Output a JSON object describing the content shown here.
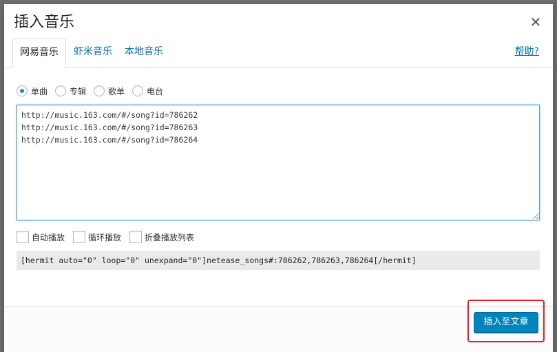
{
  "dialog": {
    "title": "插入音乐",
    "close_icon": "close-icon"
  },
  "tabs": [
    {
      "label": "网易音乐",
      "active": true
    },
    {
      "label": "虾米音乐",
      "active": false
    },
    {
      "label": "本地音乐",
      "active": false
    }
  ],
  "help_link": "帮助?",
  "type_options": [
    {
      "label": "单曲",
      "checked": true
    },
    {
      "label": "专辑",
      "checked": false
    },
    {
      "label": "歌单",
      "checked": false
    },
    {
      "label": "电台",
      "checked": false
    }
  ],
  "url_input": {
    "lines": [
      "http://music.163.com/#/song?id=786262",
      "http://music.163.com/#/song?id=786263",
      "http://music.163.com/#/song?id=786264"
    ]
  },
  "options": [
    {
      "label": "自动播放",
      "checked": false
    },
    {
      "label": "循环播放",
      "checked": false
    },
    {
      "label": "折叠播放列表",
      "checked": false
    }
  ],
  "shortcode": "[hermit auto=\"0\" loop=\"0\" unexpand=\"0\"]netease_songs#:786262,786263,786264[/hermit]",
  "footer": {
    "insert_label": "插入至文章"
  },
  "colors": {
    "primary_button": "#0085ba",
    "link": "#0073aa",
    "highlight": "#e02020"
  }
}
